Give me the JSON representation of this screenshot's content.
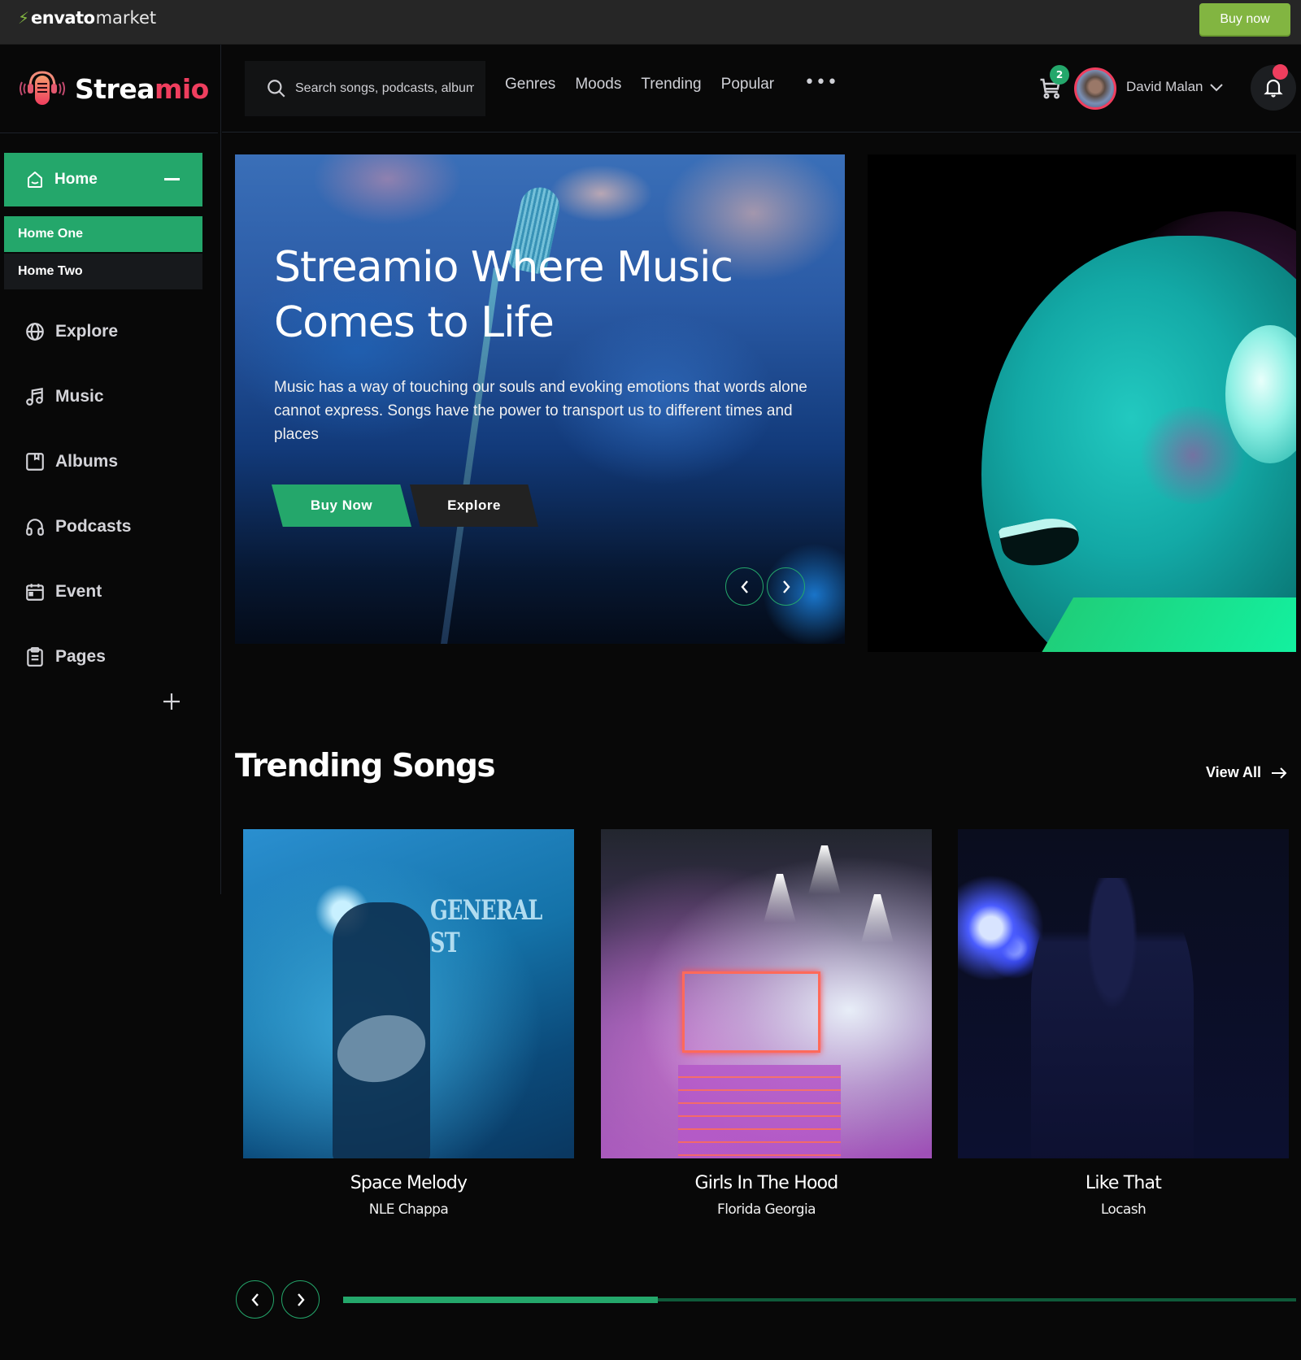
{
  "envato": {
    "brand": "envato",
    "market": "market",
    "buy_now": "Buy now",
    "icon": "leaf-bolt-icon"
  },
  "app": {
    "logo_part1": "Strea",
    "logo_part2": "mio",
    "accent_green": "#24a76b",
    "accent_red": "#ef3e5e"
  },
  "sidebar": {
    "home": {
      "label": "Home",
      "icon": "home-icon",
      "expanded": true
    },
    "home_sub": [
      {
        "label": "Home One",
        "active": true
      },
      {
        "label": "Home Two",
        "active": false
      }
    ],
    "items": [
      {
        "label": "Explore",
        "icon": "globe-icon"
      },
      {
        "label": "Music",
        "icon": "music-note-icon"
      },
      {
        "label": "Albums",
        "icon": "album-icon"
      },
      {
        "label": "Podcasts",
        "icon": "headphones-icon"
      },
      {
        "label": "Event",
        "icon": "calendar-icon"
      },
      {
        "label": "Pages",
        "icon": "clipboard-icon"
      }
    ]
  },
  "header": {
    "search_placeholder": "Search songs, podcasts, albums",
    "menu": [
      "Genres",
      "Moods",
      "Trending",
      "Popular"
    ],
    "more": "•••",
    "cart_count": "2",
    "user_name": "David Malan"
  },
  "hero": {
    "title": "Streamio Where Music Comes to Life",
    "description": "Music has a way of touching our souls and evoking emotions that words alone cannot express. Songs have the power to transport us to different times and places",
    "buy_button": "Buy Now",
    "explore_button": "Explore"
  },
  "trending": {
    "title": "Trending Songs",
    "view_all": "View All",
    "songs": [
      {
        "title": "Space Melody",
        "artist": "NLE Chappa"
      },
      {
        "title": "Girls In The Hood",
        "artist": "Florida Georgia"
      },
      {
        "title": "Like That",
        "artist": "Locash"
      }
    ],
    "image_sign_text": "GENERAL ST",
    "progress": 0.33
  }
}
